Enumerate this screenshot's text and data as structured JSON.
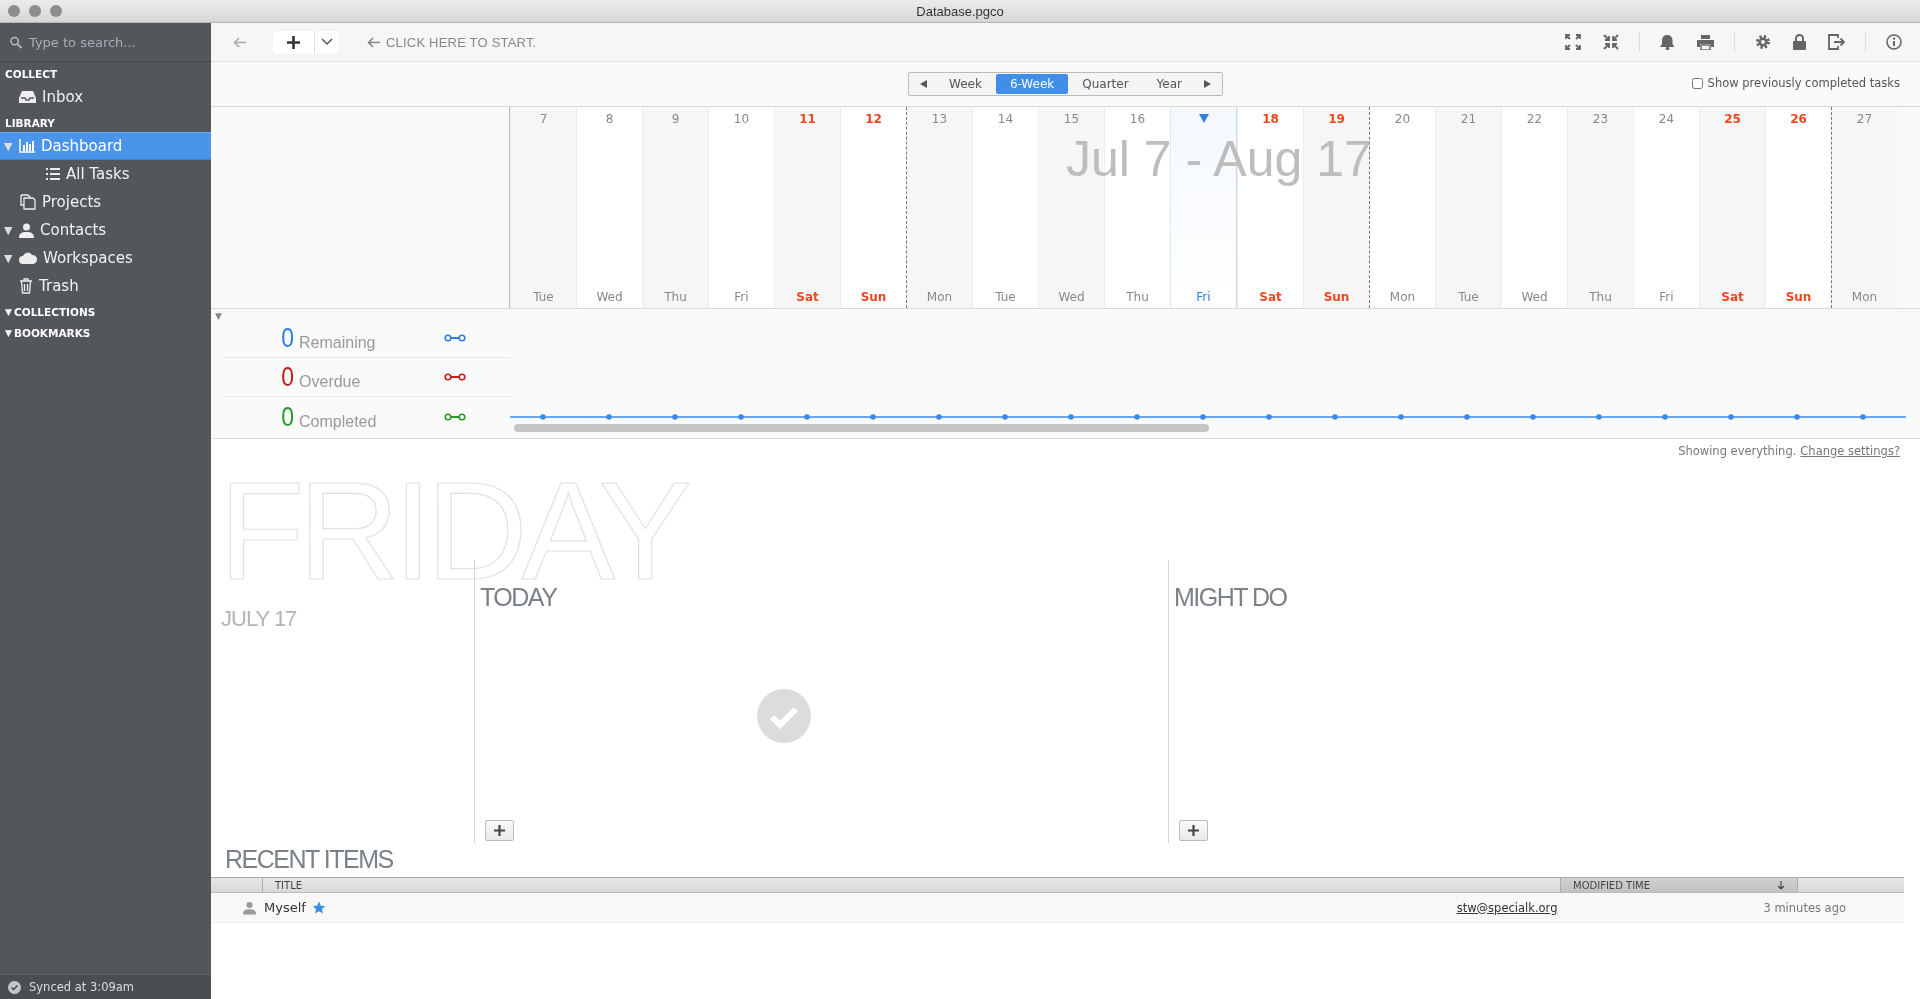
{
  "window": {
    "title": "Database.pgco"
  },
  "sidebar": {
    "search": {
      "placeholder": "Type to search..."
    },
    "sections": [
      {
        "title": "COLLECT",
        "items": [
          {
            "label": "Inbox",
            "selected": false
          }
        ]
      },
      {
        "title": "LIBRARY",
        "items": [
          {
            "label": "Dashboard",
            "toggle": "▼",
            "selected": true,
            "children": [
              {
                "label": "All Tasks",
                "selected": false
              }
            ]
          },
          {
            "label": "Projects",
            "selected": false
          },
          {
            "label": "Contacts",
            "toggle": "▼",
            "selected": false
          },
          {
            "label": "Workspaces",
            "toggle": "▼",
            "selected": false
          },
          {
            "label": "Trash",
            "selected": false
          }
        ]
      },
      {
        "title": "COLLECTIONS",
        "toggle": "▼"
      },
      {
        "title": "BOOKMARKS",
        "toggle": "▼"
      }
    ],
    "status": "Synced at 3:09am"
  },
  "toolbar": {
    "hint": "CLICK HERE TO START."
  },
  "period": {
    "options": [
      {
        "label": "Week",
        "selected": false
      },
      {
        "label": "6-Week",
        "selected": true
      },
      {
        "label": "Quarter",
        "selected": false
      },
      {
        "label": "Year",
        "selected": false
      }
    ],
    "show_completed": {
      "label": "Show previously completed tasks",
      "checked": false
    }
  },
  "calendar": {
    "range": "Jul 7 - Aug 17",
    "days": [
      {
        "day": "7",
        "weekday": "Tue",
        "weekend": false,
        "week_start": false,
        "today": false
      },
      {
        "day": "8",
        "weekday": "Wed",
        "weekend": false,
        "week_start": false,
        "today": false
      },
      {
        "day": "9",
        "weekday": "Thu",
        "weekend": false,
        "week_start": false,
        "today": false
      },
      {
        "day": "10",
        "weekday": "Fri",
        "weekend": false,
        "week_start": false,
        "today": false
      },
      {
        "day": "11",
        "weekday": "Sat",
        "weekend": true,
        "week_start": false,
        "today": false
      },
      {
        "day": "12",
        "weekday": "Sun",
        "weekend": true,
        "week_start": false,
        "today": false
      },
      {
        "day": "13",
        "weekday": "Mon",
        "weekend": false,
        "week_start": true,
        "today": false
      },
      {
        "day": "14",
        "weekday": "Tue",
        "weekend": false,
        "week_start": false,
        "today": false
      },
      {
        "day": "15",
        "weekday": "Wed",
        "weekend": false,
        "week_start": false,
        "today": false
      },
      {
        "day": "16",
        "weekday": "Thu",
        "weekend": false,
        "week_start": false,
        "today": false
      },
      {
        "weekday": "Fri",
        "weekend": false,
        "week_start": false,
        "today": true
      },
      {
        "day": "18",
        "weekday": "Sat",
        "weekend": true,
        "week_start": false,
        "today": false
      },
      {
        "day": "19",
        "weekday": "Sun",
        "weekend": true,
        "week_start": false,
        "today": false
      },
      {
        "day": "20",
        "weekday": "Mon",
        "weekend": false,
        "week_start": true,
        "today": false
      },
      {
        "day": "21",
        "weekday": "Tue",
        "weekend": false,
        "week_start": false,
        "today": false
      },
      {
        "day": "22",
        "weekday": "Wed",
        "weekend": false,
        "week_start": false,
        "today": false
      },
      {
        "day": "23",
        "weekday": "Thu",
        "weekend": false,
        "week_start": false,
        "today": false
      },
      {
        "day": "24",
        "weekday": "Fri",
        "weekend": false,
        "week_start": false,
        "today": false
      },
      {
        "day": "25",
        "weekday": "Sat",
        "weekend": true,
        "week_start": false,
        "today": false
      },
      {
        "day": "26",
        "weekday": "Sun",
        "weekend": true,
        "week_start": false,
        "today": false
      },
      {
        "day": "27",
        "weekday": "Mon",
        "weekend": false,
        "week_start": true,
        "today": false
      }
    ]
  },
  "legend_toggle": "▼",
  "legend": [
    {
      "count": "0",
      "label": "Remaining",
      "color": "#2f7fd8"
    },
    {
      "count": "0",
      "label": "Overdue",
      "color": "#c41e1e"
    },
    {
      "count": "0",
      "label": "Completed",
      "color": "#2a9a2a"
    }
  ],
  "filter_note": {
    "text": "Showing everything.",
    "link": "Change settings?"
  },
  "dashboard": {
    "day": "FRIDAY",
    "date": "JULY 17",
    "columns": [
      {
        "title": "TODAY",
        "empty": true
      },
      {
        "title": "MIGHT DO",
        "empty": false
      }
    ]
  },
  "recent": {
    "title": "RECENT ITEMS",
    "columns": [
      {
        "label": "TITLE",
        "sorted": false
      },
      {
        "label": "MODIFIED TIME",
        "sorted": true
      }
    ],
    "rows": [
      {
        "title": "Myself",
        "starred": true,
        "email": "stw@specialk.org",
        "modified": "3 minutes ago"
      }
    ]
  }
}
